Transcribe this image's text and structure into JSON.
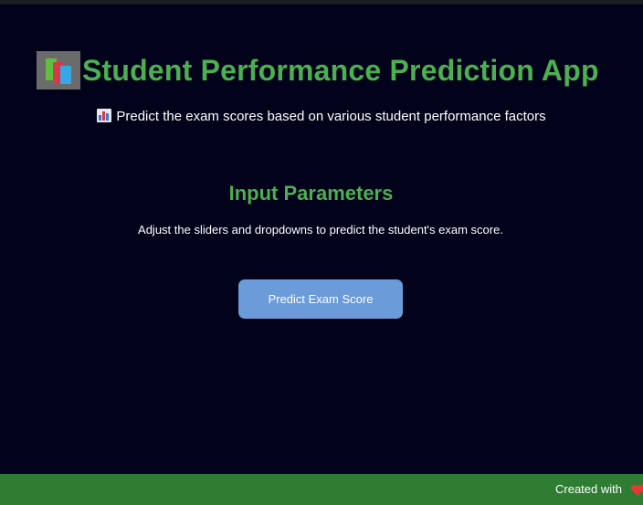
{
  "app": {
    "title": "Student Performance Prediction App",
    "title_icon": "books-icon",
    "subtitle": "Predict the exam scores based on various student performance factors",
    "subtitle_icon": "bar-chart-icon"
  },
  "section": {
    "title": "Input Parameters",
    "description": "Adjust the sliders and dropdowns to predict the student's exam score."
  },
  "actions": {
    "predict_label": "Predict Exam Score"
  },
  "footer": {
    "text": "Created with",
    "icon": "heart-icon"
  },
  "colors": {
    "background": "#02021a",
    "accent_green": "#4caf50",
    "footer_green": "#2e7d32",
    "button_blue": "#6b9bd8",
    "heart_red": "#e53935"
  }
}
